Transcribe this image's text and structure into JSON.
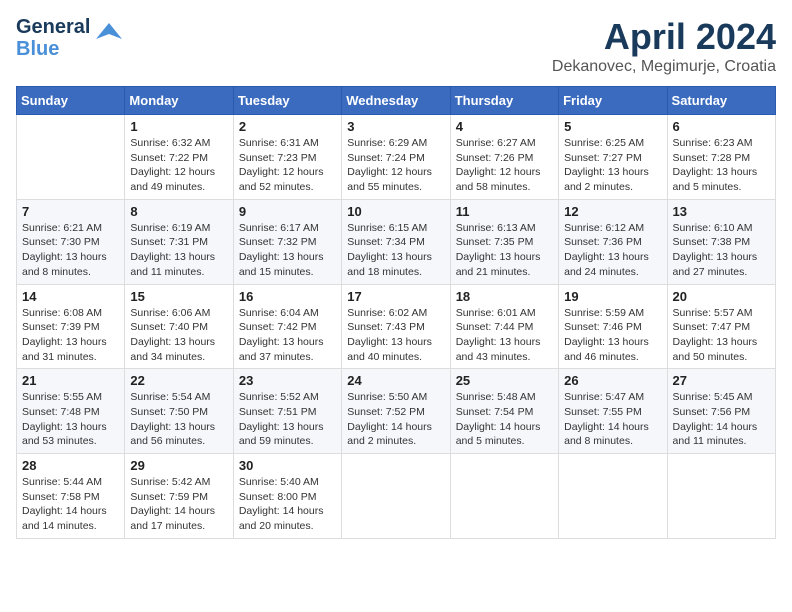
{
  "logo": {
    "line1": "General",
    "line2": "Blue"
  },
  "header": {
    "title": "April 2024",
    "subtitle": "Dekanovec, Megimurje, Croatia"
  },
  "days_of_week": [
    "Sunday",
    "Monday",
    "Tuesday",
    "Wednesday",
    "Thursday",
    "Friday",
    "Saturday"
  ],
  "weeks": [
    [
      {
        "day": "",
        "info": ""
      },
      {
        "day": "1",
        "info": "Sunrise: 6:32 AM\nSunset: 7:22 PM\nDaylight: 12 hours\nand 49 minutes."
      },
      {
        "day": "2",
        "info": "Sunrise: 6:31 AM\nSunset: 7:23 PM\nDaylight: 12 hours\nand 52 minutes."
      },
      {
        "day": "3",
        "info": "Sunrise: 6:29 AM\nSunset: 7:24 PM\nDaylight: 12 hours\nand 55 minutes."
      },
      {
        "day": "4",
        "info": "Sunrise: 6:27 AM\nSunset: 7:26 PM\nDaylight: 12 hours\nand 58 minutes."
      },
      {
        "day": "5",
        "info": "Sunrise: 6:25 AM\nSunset: 7:27 PM\nDaylight: 13 hours\nand 2 minutes."
      },
      {
        "day": "6",
        "info": "Sunrise: 6:23 AM\nSunset: 7:28 PM\nDaylight: 13 hours\nand 5 minutes."
      }
    ],
    [
      {
        "day": "7",
        "info": "Sunrise: 6:21 AM\nSunset: 7:30 PM\nDaylight: 13 hours\nand 8 minutes."
      },
      {
        "day": "8",
        "info": "Sunrise: 6:19 AM\nSunset: 7:31 PM\nDaylight: 13 hours\nand 11 minutes."
      },
      {
        "day": "9",
        "info": "Sunrise: 6:17 AM\nSunset: 7:32 PM\nDaylight: 13 hours\nand 15 minutes."
      },
      {
        "day": "10",
        "info": "Sunrise: 6:15 AM\nSunset: 7:34 PM\nDaylight: 13 hours\nand 18 minutes."
      },
      {
        "day": "11",
        "info": "Sunrise: 6:13 AM\nSunset: 7:35 PM\nDaylight: 13 hours\nand 21 minutes."
      },
      {
        "day": "12",
        "info": "Sunrise: 6:12 AM\nSunset: 7:36 PM\nDaylight: 13 hours\nand 24 minutes."
      },
      {
        "day": "13",
        "info": "Sunrise: 6:10 AM\nSunset: 7:38 PM\nDaylight: 13 hours\nand 27 minutes."
      }
    ],
    [
      {
        "day": "14",
        "info": "Sunrise: 6:08 AM\nSunset: 7:39 PM\nDaylight: 13 hours\nand 31 minutes."
      },
      {
        "day": "15",
        "info": "Sunrise: 6:06 AM\nSunset: 7:40 PM\nDaylight: 13 hours\nand 34 minutes."
      },
      {
        "day": "16",
        "info": "Sunrise: 6:04 AM\nSunset: 7:42 PM\nDaylight: 13 hours\nand 37 minutes."
      },
      {
        "day": "17",
        "info": "Sunrise: 6:02 AM\nSunset: 7:43 PM\nDaylight: 13 hours\nand 40 minutes."
      },
      {
        "day": "18",
        "info": "Sunrise: 6:01 AM\nSunset: 7:44 PM\nDaylight: 13 hours\nand 43 minutes."
      },
      {
        "day": "19",
        "info": "Sunrise: 5:59 AM\nSunset: 7:46 PM\nDaylight: 13 hours\nand 46 minutes."
      },
      {
        "day": "20",
        "info": "Sunrise: 5:57 AM\nSunset: 7:47 PM\nDaylight: 13 hours\nand 50 minutes."
      }
    ],
    [
      {
        "day": "21",
        "info": "Sunrise: 5:55 AM\nSunset: 7:48 PM\nDaylight: 13 hours\nand 53 minutes."
      },
      {
        "day": "22",
        "info": "Sunrise: 5:54 AM\nSunset: 7:50 PM\nDaylight: 13 hours\nand 56 minutes."
      },
      {
        "day": "23",
        "info": "Sunrise: 5:52 AM\nSunset: 7:51 PM\nDaylight: 13 hours\nand 59 minutes."
      },
      {
        "day": "24",
        "info": "Sunrise: 5:50 AM\nSunset: 7:52 PM\nDaylight: 14 hours\nand 2 minutes."
      },
      {
        "day": "25",
        "info": "Sunrise: 5:48 AM\nSunset: 7:54 PM\nDaylight: 14 hours\nand 5 minutes."
      },
      {
        "day": "26",
        "info": "Sunrise: 5:47 AM\nSunset: 7:55 PM\nDaylight: 14 hours\nand 8 minutes."
      },
      {
        "day": "27",
        "info": "Sunrise: 5:45 AM\nSunset: 7:56 PM\nDaylight: 14 hours\nand 11 minutes."
      }
    ],
    [
      {
        "day": "28",
        "info": "Sunrise: 5:44 AM\nSunset: 7:58 PM\nDaylight: 14 hours\nand 14 minutes."
      },
      {
        "day": "29",
        "info": "Sunrise: 5:42 AM\nSunset: 7:59 PM\nDaylight: 14 hours\nand 17 minutes."
      },
      {
        "day": "30",
        "info": "Sunrise: 5:40 AM\nSunset: 8:00 PM\nDaylight: 14 hours\nand 20 minutes."
      },
      {
        "day": "",
        "info": ""
      },
      {
        "day": "",
        "info": ""
      },
      {
        "day": "",
        "info": ""
      },
      {
        "day": "",
        "info": ""
      }
    ]
  ]
}
